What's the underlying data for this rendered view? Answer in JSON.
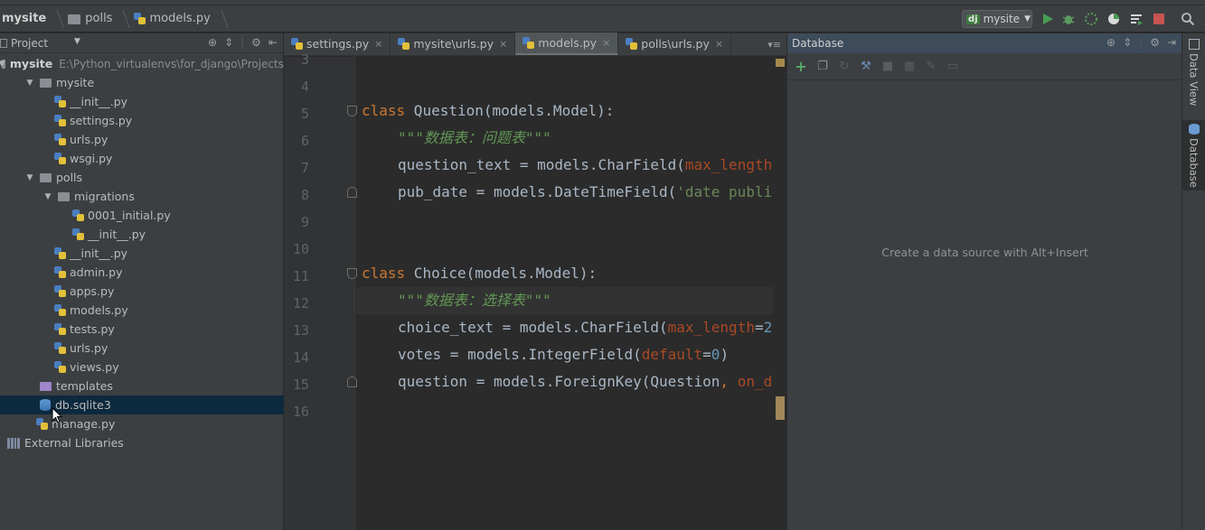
{
  "breadcrumbs": [
    {
      "label": "mysite",
      "bold": true
    },
    {
      "label": "polls",
      "bold": false
    },
    {
      "label": "models.py",
      "bold": false
    }
  ],
  "run_config": {
    "badge": "dj",
    "label": "mysite"
  },
  "project_panel": {
    "title": "Project",
    "tree": [
      {
        "label": "mysite",
        "extra": "E:\\Python_virtualenvs\\for_django\\Projects",
        "level": 0,
        "kind": "folder",
        "expanded": true,
        "bold": true
      },
      {
        "label": "mysite",
        "level": 1,
        "kind": "folder",
        "expanded": true
      },
      {
        "label": "__init__.py",
        "level": 2,
        "kind": "py"
      },
      {
        "label": "settings.py",
        "level": 2,
        "kind": "py"
      },
      {
        "label": "urls.py",
        "level": 2,
        "kind": "py"
      },
      {
        "label": "wsgi.py",
        "level": 2,
        "kind": "py"
      },
      {
        "label": "polls",
        "level": 1,
        "kind": "folder",
        "expanded": true
      },
      {
        "label": "migrations",
        "level": 2,
        "kind": "folder",
        "expanded": true
      },
      {
        "label": "0001_initial.py",
        "level": 3,
        "kind": "py"
      },
      {
        "label": "__init__.py",
        "level": 3,
        "kind": "py"
      },
      {
        "label": "__init__.py",
        "level": 2,
        "kind": "py"
      },
      {
        "label": "admin.py",
        "level": 2,
        "kind": "py"
      },
      {
        "label": "apps.py",
        "level": 2,
        "kind": "py"
      },
      {
        "label": "models.py",
        "level": 2,
        "kind": "py"
      },
      {
        "label": "tests.py",
        "level": 2,
        "kind": "py"
      },
      {
        "label": "urls.py",
        "level": 2,
        "kind": "py"
      },
      {
        "label": "views.py",
        "level": 2,
        "kind": "py"
      },
      {
        "label": "templates",
        "level": 1,
        "kind": "folder-purple"
      },
      {
        "label": "db.sqlite3",
        "level": 1,
        "kind": "db",
        "selected": true
      },
      {
        "label": "manage.py",
        "level": 1,
        "kind": "py"
      },
      {
        "label": "External Libraries",
        "level": 0,
        "kind": "lib"
      }
    ]
  },
  "editor": {
    "tabs": [
      {
        "label": "settings.py",
        "active": false
      },
      {
        "label": "mysite\\urls.py",
        "active": false
      },
      {
        "label": "models.py",
        "active": true
      },
      {
        "label": "polls\\urls.py",
        "active": false
      }
    ],
    "tabs_menu": "▾≡",
    "line_numbers": [
      "3",
      "4",
      "5",
      "6",
      "7",
      "8",
      "9",
      "10",
      "11",
      "12",
      "13",
      "14",
      "15",
      "16"
    ],
    "code": {
      "l4_kw": "class",
      "l4_rest": " Question(models.Model):",
      "l5_doc": "\"\"\"数据表：问题表\"\"\"",
      "l6_a": "question_text = models.CharField(",
      "l6_p": "max_length",
      "l7_a": "pub_date = models.DateTimeField(",
      "l7_s": "'date publi",
      "l10_kw": "class",
      "l10_rest": " Choice(models.Model):",
      "l11_doc": "\"\"\"数据表：选择表\"\"\"",
      "l12_a": "choice_text = models.CharField(",
      "l12_p": "max_length",
      "l12_eq": "=",
      "l12_n": "2",
      "l13_a": "votes = models.IntegerField(",
      "l13_p": "default",
      "l13_eq": "=",
      "l13_n": "0",
      "l13_e": ")",
      "l14_a": "question = models.ForeignKey(Question",
      "l14_c": ", ",
      "l14_p": "on_d"
    }
  },
  "database_panel": {
    "title": "Database",
    "empty_text": "Create a data source with Alt+Insert"
  },
  "right_strip": {
    "tabs": [
      {
        "label": "Data View",
        "active": false
      },
      {
        "label": "Database",
        "active": true
      }
    ]
  },
  "colors": {
    "keyword": "#cc7832",
    "docstring": "#629755",
    "param": "#aa4926",
    "number": "#6897bb",
    "string": "#6a8759",
    "selection": "#0d293e"
  }
}
